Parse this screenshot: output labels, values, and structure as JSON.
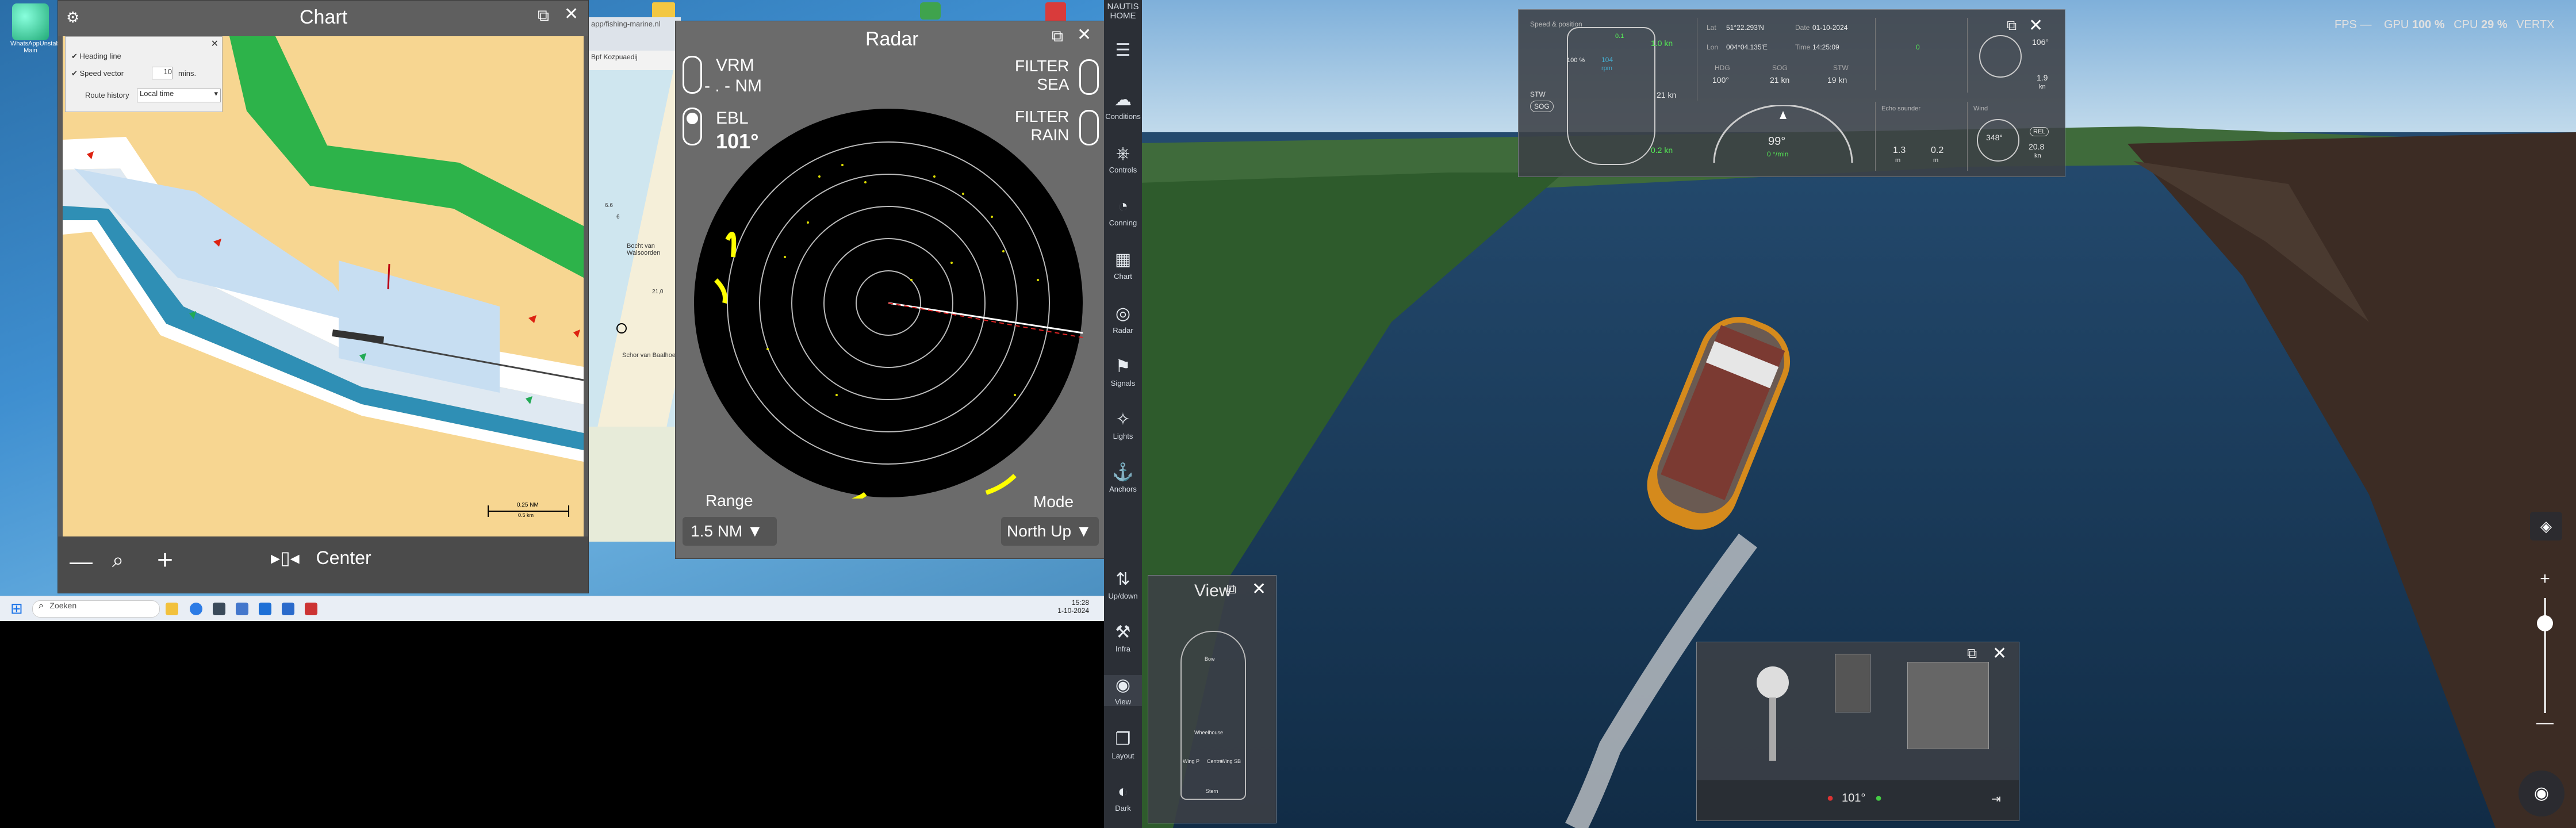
{
  "desktop": {
    "icon_label": "WhatsAppUnstable\nMain",
    "taskbar": {
      "search_placeholder": "Zoeken",
      "time": "15:28",
      "date": "1-10-2024"
    },
    "browser_address": "app/fishing-marine.nl",
    "browser_tab": "Bpf Kozpuaedij",
    "map_labels": [
      "Bocht van Walsoorden",
      "Schor van Baalhoek",
      "21,0",
      "6.6",
      "6"
    ]
  },
  "chart": {
    "title": "Chart",
    "settings": {
      "heading_line": "Heading line",
      "speed_vector": "Speed vector",
      "speed_value": "10",
      "speed_unit": "mins.",
      "route_history": "Route history",
      "route_option": "Local time"
    },
    "scale_label": "0.25 NM",
    "scale_sub": "0.5 km",
    "center_label": "Center"
  },
  "radar": {
    "title": "Radar",
    "vrm_label": "VRM",
    "vrm_value": "- . - NM",
    "ebl_label": "EBL",
    "ebl_value": "101°",
    "filter_sea": "FILTER\nSEA",
    "filter_rain": "FILTER\nRAIN",
    "range_label": "Range",
    "range_value": "1.5 NM",
    "mode_label": "Mode",
    "mode_value": "North Up"
  },
  "sidebar": {
    "brand": "NAUTIS\nHOME",
    "items": [
      {
        "label": "Conditions"
      },
      {
        "label": "Controls"
      },
      {
        "label": "Conning"
      },
      {
        "label": "Chart"
      },
      {
        "label": "Radar"
      },
      {
        "label": "Signals"
      },
      {
        "label": "Lights"
      },
      {
        "label": "Anchors"
      },
      {
        "label": "Up/down"
      },
      {
        "label": "Infra"
      },
      {
        "label": "View"
      },
      {
        "label": "Layout"
      },
      {
        "label": "Dark"
      }
    ]
  },
  "topbar": {
    "fps_label": "FPS",
    "fps_value": "—",
    "gpu_label": "GPU",
    "gpu_value": "100 %",
    "cpu_label": "CPU",
    "cpu_value": "29 %",
    "vertx": "VERTX"
  },
  "conning": {
    "speed_title": "Speed & position",
    "stw": "STW",
    "sog": "SOG",
    "speed_big": "104",
    "speed_unit": "rpm",
    "lat_label": "Lat",
    "lat": "51°22.293'N",
    "lon_label": "Lon",
    "lon": "004°04.135'E",
    "date_label": "Date",
    "date": "01-10-2024",
    "time_label": "Time",
    "time": "14:25:09",
    "hdg_label": "HDG",
    "hdg": "100°",
    "sog_label": "SOG",
    "sog_val": "21 kn",
    "stw_val": "19 kn",
    "rudder": "99°",
    "compass": "106°",
    "wind_label": "Wind",
    "wind": "348°",
    "wind_speed": "20.8",
    "wind_unit": "kn",
    "rel": "REL",
    "val_1": "1.0 kn",
    "val_2": "0.2 kn",
    "val_3": "21 kn",
    "depth1": "1.3",
    "depth2": "0.2",
    "depth_unit": "m",
    "echo": "Echo sounder",
    "e_val": "1.9",
    "e_unit": "kn",
    "pct": "100 %",
    "green1": "0.1",
    "green2": "0",
    "gauge_mid": "0 °/min"
  },
  "view": {
    "title": "View",
    "labels": [
      "Bow",
      "Wheelhouse",
      "Wing P",
      "Centre",
      "Wing SB",
      "Stern"
    ]
  },
  "controls": {
    "heading": "101°"
  }
}
